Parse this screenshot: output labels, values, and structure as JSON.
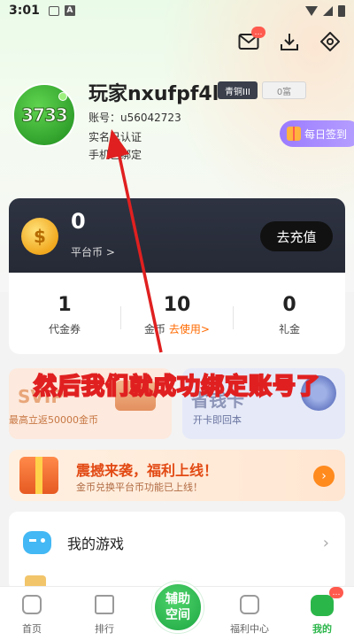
{
  "status_bar": {
    "time": "3:01",
    "a_icon": "A"
  },
  "top_icons": {
    "mail_badge": "…"
  },
  "profile": {
    "avatar_text": "3733",
    "username": "玩家nxufpf4l",
    "level": "青铜III",
    "rich": "0富",
    "account_label": "账号：",
    "account_value": "u56042723",
    "realname_prefix": "实名",
    "realname_status": "已认证",
    "phone_prefix": "手机",
    "phone_status": "已绑定",
    "checkin_label": "每日签到"
  },
  "wallet": {
    "coin_count": "0",
    "coin_label": "平台币 >",
    "recharge_label": "去充值"
  },
  "stats": [
    {
      "value": "1",
      "label": "代金券"
    },
    {
      "value": "10",
      "label": "金币",
      "link": "去使用>"
    },
    {
      "value": "0",
      "label": "礼金"
    }
  ],
  "promo": {
    "left_title": "SVIP",
    "left_sub": "最高立返50000金币",
    "right_title": "省钱卡",
    "right_sub": "开卡即回本"
  },
  "overlay_caption": "然后我们就成功绑定账号了",
  "banner": {
    "title": "震撼来袭，福利上线！",
    "subtitle": "金币兑换平台币功能已上线！"
  },
  "menu": {
    "my_games": "我的游戏",
    "chevron": "›"
  },
  "bottom_nav": {
    "home": "首页",
    "rank": "排行",
    "assist_line1": "辅助",
    "assist_line2": "空间",
    "welfare": "福利中心",
    "mine": "我的",
    "mine_badge": "…"
  },
  "colors": {
    "accent_green": "#2bb64a",
    "annotation_red": "#e02020",
    "recharge_bg": "#111111"
  }
}
